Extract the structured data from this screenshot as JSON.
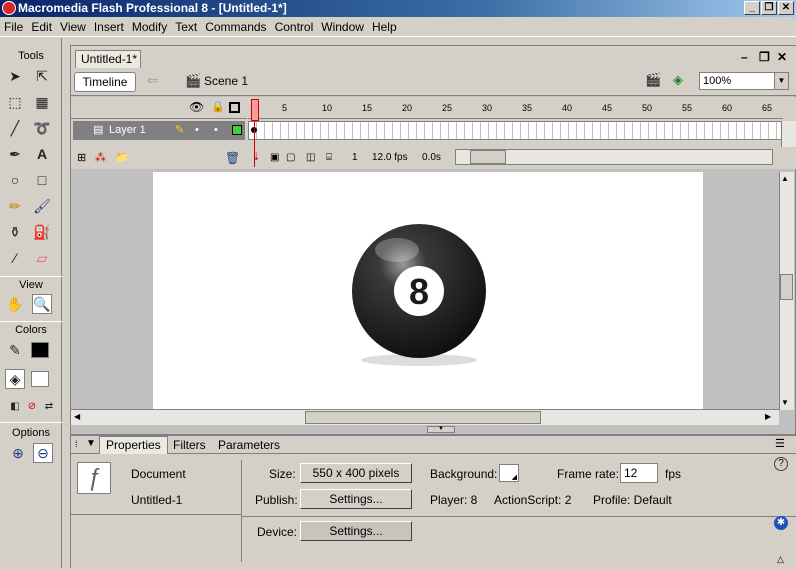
{
  "window": {
    "title": "Macromedia Flash Professional 8 - [Untitled-1*]"
  },
  "menu": [
    "File",
    "Edit",
    "View",
    "Insert",
    "Modify",
    "Text",
    "Commands",
    "Control",
    "Window",
    "Help"
  ],
  "tools": {
    "header": "Tools",
    "view_label": "View",
    "colors_label": "Colors",
    "options_label": "Options",
    "stroke_color": "#000000",
    "fill_color": "#ffffff"
  },
  "document": {
    "tab_label": "Untitled-1*",
    "timeline_button": "Timeline",
    "scene_label": "Scene 1",
    "zoom": "100%"
  },
  "timeline": {
    "layer_name": "Layer 1",
    "frame_numbers": [
      "1",
      "5",
      "10",
      "15",
      "20",
      "25",
      "30",
      "35",
      "40",
      "45",
      "50",
      "55",
      "60",
      "65"
    ],
    "current_frame": "1",
    "frame_rate": "12.0 fps",
    "elapsed": "0.0s"
  },
  "stage": {
    "ball_number": "8",
    "ball_color": "#111111"
  },
  "properties": {
    "tabs": [
      "Properties",
      "Filters",
      "Parameters"
    ],
    "type": "Document",
    "name": "Untitled-1",
    "size_label": "Size:",
    "size_value": "550 x 400 pixels",
    "publish_label": "Publish:",
    "publish_button": "Settings...",
    "device_label": "Device:",
    "device_button": "Settings...",
    "background_label": "Background:",
    "background_color": "#ffffff",
    "frame_rate_label": "Frame rate:",
    "frame_rate_value": "12",
    "fps_label": "fps",
    "player": "Player: 8",
    "actionscript": "ActionScript:  2",
    "profile": "Profile:  Default"
  }
}
